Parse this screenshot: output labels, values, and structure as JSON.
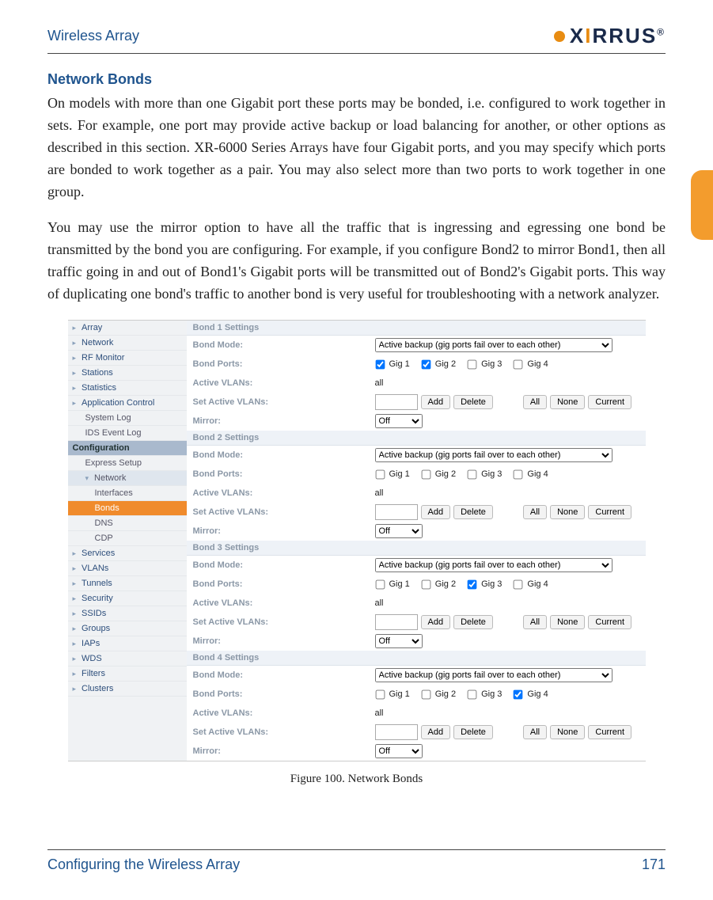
{
  "header": {
    "running": "Wireless Array",
    "logo_text_pre": "X",
    "logo_text_i": "I",
    "logo_text_post": "RRUS",
    "reg": "®"
  },
  "section_title": "Network Bonds",
  "para1": "On models with more than one Gigabit port these ports may be bonded, i.e. configured to work together in sets. For example, one port may provide active backup or load balancing for another, or other options as described in this section. XR-6000 Series Arrays have four Gigabit ports, and you may specify which ports are bonded to work together as a pair. You may also select more than two ports to work together in one group.",
  "para2": "You may use the mirror option to have all the traffic that is ingressing and egressing one bond be transmitted by the bond you are configuring. For example, if you configure Bond2 to mirror Bond1, then all traffic going in and out of Bond1's Gigabit ports will be transmitted out of Bond2's Gigabit ports. This way of duplicating one bond's traffic to another bond is very useful for troubleshooting with a network analyzer.",
  "nav": {
    "top": [
      "Array",
      "Network",
      "RF Monitor",
      "Stations",
      "Statistics",
      "Application Control"
    ],
    "plain": [
      "System Log",
      "IDS Event Log"
    ],
    "config": "Configuration",
    "subs": [
      "Express Setup",
      "Network"
    ],
    "netsubs": [
      "Interfaces",
      "Bonds",
      "DNS",
      "CDP"
    ],
    "bottom": [
      "Services",
      "VLANs",
      "Tunnels",
      "Security",
      "SSIDs",
      "Groups",
      "IAPs",
      "WDS",
      "Filters",
      "Clusters"
    ]
  },
  "panel": {
    "labels": {
      "mode": "Bond Mode:",
      "ports": "Bond Ports:",
      "avlans": "Active VLANs:",
      "setvlans": "Set Active VLANs:",
      "mirror": "Mirror:"
    },
    "buttons": {
      "add": "Add",
      "delete": "Delete",
      "all": "All",
      "none": "None",
      "current": "Current"
    },
    "mode_option": "Active backup (gig ports fail over to each other)",
    "mirror_option": "Off",
    "gigs": [
      "Gig 1",
      "Gig 2",
      "Gig 3",
      "Gig 4"
    ],
    "all_value": "all",
    "bonds": [
      {
        "title": "Bond 1 Settings",
        "checked": [
          true,
          true,
          false,
          false
        ]
      },
      {
        "title": "Bond 2 Settings",
        "checked": [
          false,
          false,
          false,
          false
        ]
      },
      {
        "title": "Bond 3 Settings",
        "checked": [
          false,
          false,
          true,
          false
        ]
      },
      {
        "title": "Bond 4 Settings",
        "checked": [
          false,
          false,
          false,
          true
        ]
      }
    ]
  },
  "caption": "Figure 100. Network Bonds",
  "footer": {
    "left": "Configuring the Wireless Array",
    "right": "171"
  }
}
